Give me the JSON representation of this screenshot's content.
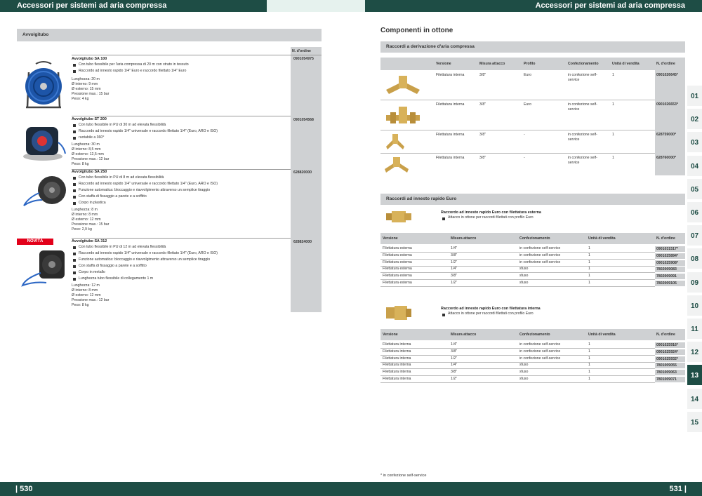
{
  "header": {
    "left_title": "Accessori per sistemi ad aria compressa",
    "right_title": "Accessori per sistemi ad aria compressa"
  },
  "footer": {
    "left_page": "| 530",
    "right_page": "531 |",
    "note": "* in confezione self-service"
  },
  "left": {
    "section_title": "Avvolgitubo",
    "order_header": "N. d'ordine",
    "novita_badge": "NOVITÀ",
    "products": [
      {
        "name": "Avvolgitubo SA 100",
        "order": "0901054975",
        "bullets": [
          "Con tubo flessibile per l'aria compressa di 20 m con strato in tessuto",
          "Raccordo ad innesto rapido 1/4\" Euro e raccordo filettato 1/4\" Euro"
        ],
        "specs": [
          "Lunghezza: 20 m",
          "Ø interno: 9 mm",
          "Ø esterno: 15 mm",
          "Pressione max.: 15 bar",
          "Peso: 4 kg"
        ]
      },
      {
        "name": "Avvolgitubo ST 200",
        "order": "0901054568",
        "bullets": [
          "Con tubo flessibile in PU di 30 m ad elevata flessibilità",
          "Raccordo ad innesto rapido 1/4\" universale e raccordo filettato 1/4\" (Euro, ARO e ISO)",
          "ruotabile a 360°"
        ],
        "specs": [
          "Lunghezza: 30 m",
          "Ø interno: 8,5 mm",
          "Ø esterno: 12,5 mm",
          "Pressione max.: 12 bar",
          "Peso: 8 kg"
        ]
      },
      {
        "name": "Avvolgitubo SA 250",
        "order": "628820000",
        "bullets": [
          "Con tubo flessibile in PU di 8 m ad elevata flessibilità",
          "Raccordo ad innesto rapido 1/4\" universale e raccordo filettato 1/4\" (Euro, ARO e ISO)",
          "Funzione automatica: bloccaggio e riavvolgimento attraverso un semplice tiraggio",
          "Con staffa di fissaggio a parete e a soffitto",
          "Corpo in plastica"
        ],
        "specs": [
          "Lunghezza: 8 m",
          "Ø interno: 8 mm",
          "Ø esterno: 12 mm",
          "Pressione max.: 15 bar",
          "Peso: 2,9 kg"
        ]
      },
      {
        "name": "Avvolgitubo SA 312",
        "order": "628824000",
        "bullets": [
          "Con tubo flessibile in PU di 12 m ad elevata flessibilità",
          "Raccordo ad innesto rapido 1/4\" universale e raccordo filettato 1/4\" (Euro, ARO e ISO)",
          "Funzione automatica: bloccaggio e riavvolgimento attraverso un semplice tiraggio",
          "Con staffa di fissaggio a parete e a soffitto",
          "Corpo in metallo",
          "Lunghezza tubo flessibile di collegamento 1 m"
        ],
        "specs": [
          "Lunghezza: 12 m",
          "Ø interno: 8 mm",
          "Ø esterno: 12 mm",
          "Pressione max.: 12 bar",
          "Peso: 8 kg"
        ]
      }
    ]
  },
  "right": {
    "title": "Componenti in ottone",
    "section1": {
      "title": "Raccordi a derivazione d'aria compressa",
      "headers": [
        "Versione",
        "Misura attacco",
        "Profilo",
        "Confezionamento",
        "Unità di vendita",
        "N. d'ordine"
      ],
      "rows": [
        [
          "Filettatura interna",
          "3/8\"",
          "Euro",
          "in confezione self-service",
          "1",
          "0901026645*"
        ],
        [
          "Filettatura interna",
          "3/8\"",
          "Euro",
          "in confezione self-service",
          "1",
          "0901026653*"
        ],
        [
          "Filettatura interna",
          "3/8\"",
          "-",
          "in confezione self-service",
          "1",
          "628759000*"
        ],
        [
          "Filettatura interna",
          "3/8\"",
          "-",
          "in confezione self-service",
          "1",
          "628760000*"
        ]
      ]
    },
    "section2": {
      "title": "Raccordi ad innesto rapido Euro",
      "blocks": [
        {
          "name": "Raccordo ad innesto rapido Euro con filettatura esterna",
          "bullet": "Attacco in ottone per raccordi filettati con profilo Euro",
          "headers": [
            "Versione",
            "Misura attacco",
            "Confezionamento",
            "Unità di vendita",
            "N. d'ordine"
          ],
          "rows": [
            [
              "Filettatura esterna",
              "1/4\"",
              "in confezione self-service",
              "1",
              "0901031517*"
            ],
            [
              "Filettatura esterna",
              "3/8\"",
              "in confezione self-service",
              "1",
              "0901025894*"
            ],
            [
              "Filettatura esterna",
              "1/2\"",
              "in confezione self-service",
              "1",
              "0901025908*"
            ],
            [
              "Filettatura esterna",
              "1/4\"",
              "sfuso",
              "1",
              "7802009083"
            ],
            [
              "Filettatura esterna",
              "3/8\"",
              "sfuso",
              "1",
              "7802009091"
            ],
            [
              "Filettatura esterna",
              "1/2\"",
              "sfuso",
              "1",
              "7802009105"
            ]
          ]
        },
        {
          "name": "Raccordo ad innesto rapido Euro con filettatura interna",
          "bullet": "Attacco in ottone per raccordi filettati con profilo Euro",
          "headers": [
            "Versione",
            "Misura attacco",
            "Confezionamento",
            "Unità di vendita",
            "N. d'ordine"
          ],
          "rows": [
            [
              "Filettatura interna",
              "1/4\"",
              "in confezione self-service",
              "1",
              "0901025916*"
            ],
            [
              "Filettatura interna",
              "3/8\"",
              "in confezione self-service",
              "1",
              "0901025924*"
            ],
            [
              "Filettatura interna",
              "1/2\"",
              "in confezione self-service",
              "1",
              "0901025932*"
            ],
            [
              "Filettatura interna",
              "1/4\"",
              "sfuso",
              "1",
              "7801009055"
            ],
            [
              "Filettatura interna",
              "3/8\"",
              "sfuso",
              "1",
              "7801009063"
            ],
            [
              "Filettatura interna",
              "1/2\"",
              "sfuso",
              "1",
              "7801009071"
            ]
          ]
        }
      ]
    }
  },
  "tabs": [
    "01",
    "02",
    "03",
    "04",
    "05",
    "06",
    "07",
    "08",
    "09",
    "10",
    "11",
    "12",
    "13",
    "14",
    "15"
  ],
  "active_tab": "13"
}
